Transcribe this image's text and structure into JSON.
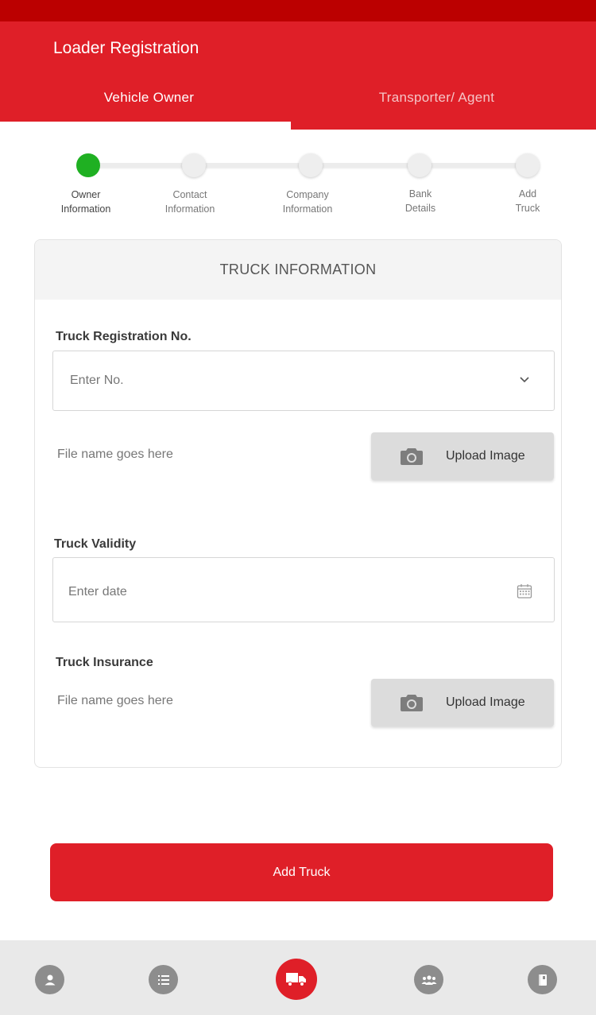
{
  "header": {
    "title": "Loader Registration",
    "tabs": [
      {
        "label": "Vehicle Owner"
      },
      {
        "label": "Transporter/ Agent"
      }
    ]
  },
  "stepper": {
    "steps": [
      {
        "line1": "Owner",
        "line2": "Information",
        "active": true
      },
      {
        "line1": "Contact",
        "line2": "Information",
        "active": false
      },
      {
        "line1": "Company",
        "line2": "Information",
        "active": false
      },
      {
        "line1": "Bank",
        "line2": "Details",
        "active": false
      },
      {
        "line1": "Add",
        "line2": "Truck",
        "active": false
      }
    ]
  },
  "card": {
    "title": "TRUCK INFORMATION",
    "registration": {
      "label": "Truck Registration No.",
      "placeholder": "Enter No.",
      "file_name": "File name goes here",
      "upload_label": "Upload Image"
    },
    "validity": {
      "label": "Truck Validity",
      "placeholder": "Enter date"
    },
    "insurance": {
      "label": "Truck Insurance",
      "file_name": "File name goes here",
      "upload_label": "Upload Image"
    }
  },
  "add_button": {
    "label": "Add Truck"
  },
  "bottom_nav": {
    "items": [
      {
        "icon": "person-icon"
      },
      {
        "icon": "list-icon"
      },
      {
        "icon": "truck-icon"
      },
      {
        "icon": "group-icon"
      },
      {
        "icon": "book-icon"
      }
    ]
  },
  "colors": {
    "primary": "#df1f28",
    "status_bar": "#bb0000",
    "step_active": "#1fb022"
  }
}
